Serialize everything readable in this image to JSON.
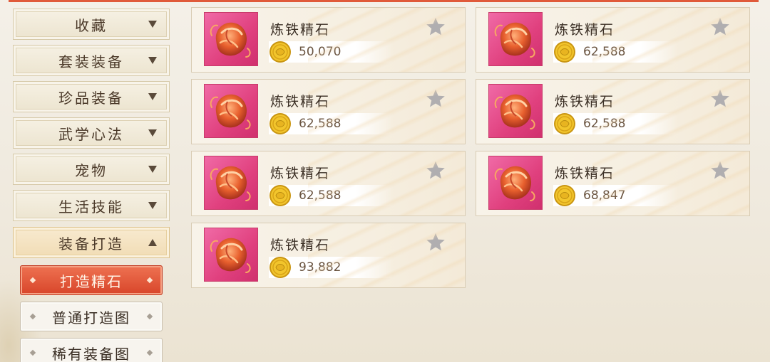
{
  "sidebar": {
    "categories": [
      {
        "label": "收藏",
        "expanded": false
      },
      {
        "label": "套装装备",
        "expanded": false
      },
      {
        "label": "珍品装备",
        "expanded": false
      },
      {
        "label": "武学心法",
        "expanded": false
      },
      {
        "label": "宠物",
        "expanded": false
      },
      {
        "label": "生活技能",
        "expanded": false
      },
      {
        "label": "装备打造",
        "expanded": true
      }
    ],
    "subitems": [
      {
        "label": "打造精石",
        "active": true
      },
      {
        "label": "普通打造图",
        "active": false
      },
      {
        "label": "稀有装备图",
        "active": false
      }
    ]
  },
  "items": [
    {
      "name": "炼铁精石",
      "price": "50,070",
      "icon": "refining-stone-icon"
    },
    {
      "name": "炼铁精石",
      "price": "62,588",
      "icon": "refining-stone-icon"
    },
    {
      "name": "炼铁精石",
      "price": "62,588",
      "icon": "refining-stone-icon"
    },
    {
      "name": "炼铁精石",
      "price": "62,588",
      "icon": "refining-stone-icon"
    },
    {
      "name": "炼铁精石",
      "price": "62,588",
      "icon": "refining-stone-icon"
    },
    {
      "name": "炼铁精石",
      "price": "68,847",
      "icon": "refining-stone-icon"
    },
    {
      "name": "炼铁精石",
      "price": "93,882",
      "icon": "refining-stone-icon"
    }
  ],
  "colors": {
    "accent": "#e05a3a",
    "active_tab": "#d8452a",
    "item_icon_bg": "#e0407e",
    "coin": "#e8b820"
  }
}
